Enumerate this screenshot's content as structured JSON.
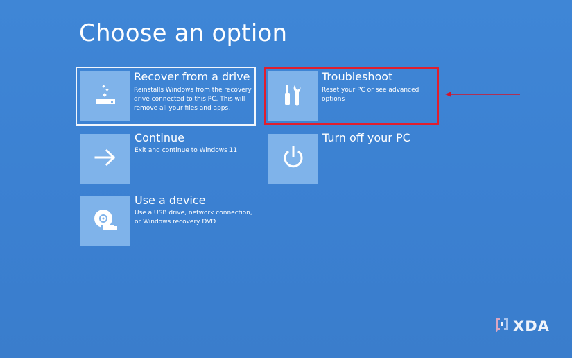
{
  "screen": {
    "title": "Choose an option"
  },
  "options": [
    {
      "id": "recover",
      "label": "Recover from a drive",
      "description": "Reinstalls Windows from the recovery drive connected to this PC. This will remove all your files and apps.",
      "icon": "drive-recover-icon"
    },
    {
      "id": "troubleshoot",
      "label": "Troubleshoot",
      "description": "Reset your PC or see advanced options",
      "icon": "tools-icon"
    },
    {
      "id": "continue",
      "label": "Continue",
      "description": "Exit and continue to Windows 11",
      "icon": "arrow-right-icon"
    },
    {
      "id": "turnoff",
      "label": "Turn off your PC",
      "description": "",
      "icon": "power-icon"
    },
    {
      "id": "device",
      "label": "Use a device",
      "description": "Use a USB drive, network connection, or Windows recovery DVD",
      "icon": "disc-device-icon"
    }
  ],
  "annotation": {
    "highlight_color": "#e01e2e",
    "arrow_color": "#d4142a"
  },
  "watermark": {
    "text": "XDA"
  },
  "colors": {
    "background": "#3b80d1",
    "tile": "#7fb3ea",
    "text": "#ffffff"
  }
}
